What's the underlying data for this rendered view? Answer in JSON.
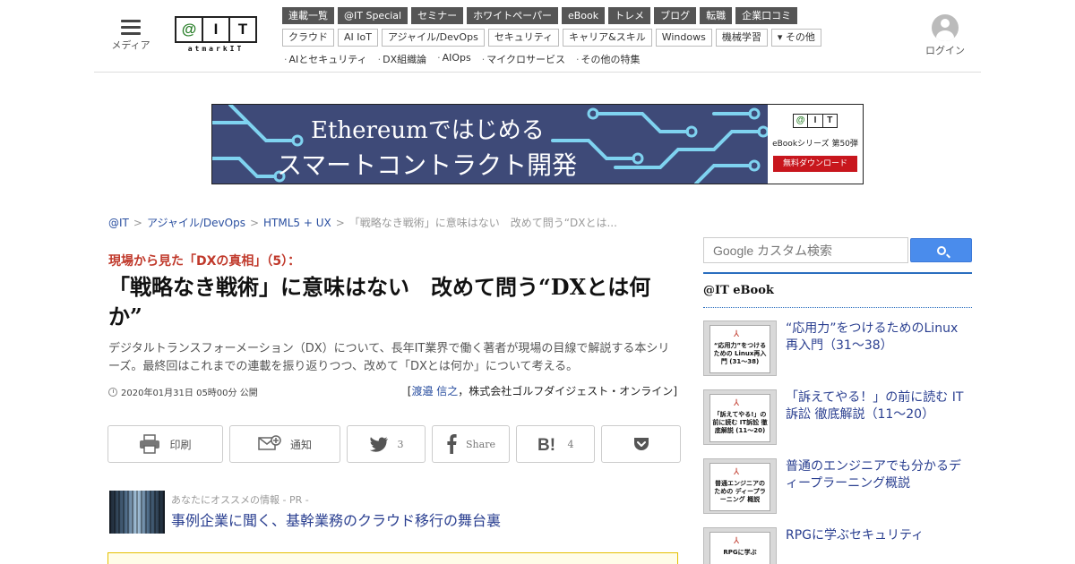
{
  "header": {
    "menu_label": "メディア",
    "logo_letters": [
      "@",
      "I",
      "T"
    ],
    "logo_sub": "atmarkIT",
    "nav_primary": [
      "連載一覧",
      "@IT Special",
      "セミナー",
      "ホワイトペーパー",
      "eBook",
      "トレメ",
      "ブログ",
      "転職",
      "企業口コミ"
    ],
    "nav_secondary": [
      "クラウド",
      "AI IoT",
      "アジャイル/DevOps",
      "セキュリティ",
      "キャリア&スキル",
      "Windows",
      "機械学習",
      "▾ その他"
    ],
    "nav_features": [
      "AIとセキュリティ",
      "DX組織論",
      "AIOps",
      "マイクロサービス",
      "その他の特集"
    ],
    "login_label": "ログイン"
  },
  "banner": {
    "line1": "Ethereumではじめる",
    "line2": "スマートコントラクト開発",
    "series": "eBookシリーズ 第50弾",
    "download": "無料ダウンロード"
  },
  "breadcrumb": {
    "items": [
      "@IT",
      "アジャイル/DevOps",
      "HTML5 + UX"
    ],
    "current": "「戦略なき戦術」に意味はない　改めて問う“DXとは..."
  },
  "article": {
    "series": "現場から見た「DXの真相」（5）：",
    "title": "「戦略なき戦術」に意味はない　改めて問う“DXとは何か”",
    "lead": "デジタルトランスフォーメーション（DX）について、長年IT業界で働く著者が現場の目線で解説する本シリーズ。最終回はこれまでの連載を振り返りつつ、改めて「DXとは何か」について考える。",
    "published": "2020年01月31日 05時00分 公開",
    "author_name": "渡邉 信之",
    "author_org": "，株式会社ゴルフダイジェスト・オンライン"
  },
  "share": {
    "print": "印刷",
    "notify": "通知",
    "twitter_count": "3",
    "facebook": "Share",
    "hatena_count": "4"
  },
  "pr": {
    "label": "あなたにオススメの情報 - PR -",
    "link": "事例企業に聞く、基幹業務のクラウド移行の舞台裏"
  },
  "sidebar": {
    "search_placeholder": "Google カスタム検索",
    "ebook_heading": "@IT eBook",
    "ebooks": [
      {
        "title": "“応用力”をつけるためのLinux再入門（31～38）",
        "cover": "“応用力”をつけるための Linux再入門 (31～38)"
      },
      {
        "title": "「訴えてやる！」の前に読む IT訴訟 徹底解説（11～20）",
        "cover": "「訴えてやる!」の前に読む IT訴訟 徹底解説 (11～20)"
      },
      {
        "title": "普通のエンジニアでも分かるディープラーニング概説",
        "cover": "普通エンジニアのための ディープラーニング 概説"
      },
      {
        "title": "RPGに学ぶセキュリティ",
        "cover": "RPGに学ぶ"
      }
    ]
  }
}
